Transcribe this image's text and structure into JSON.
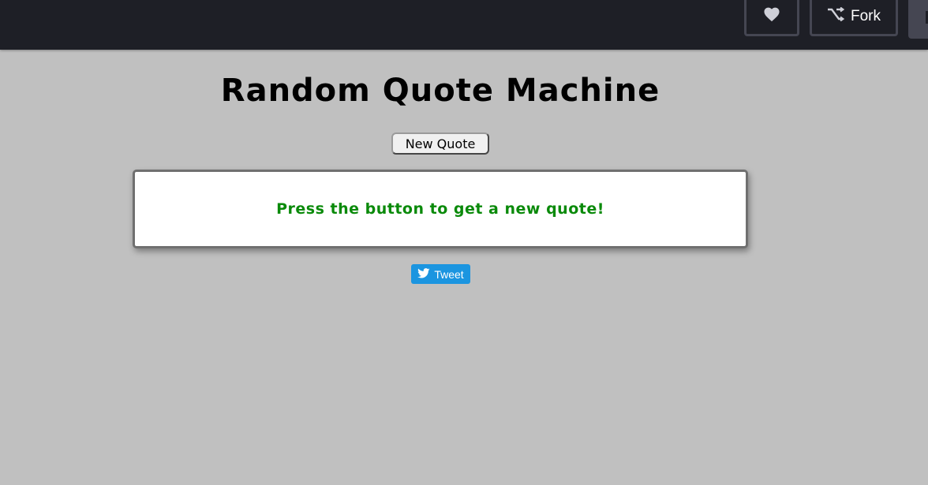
{
  "topbar": {
    "heart_icon": "heart-icon",
    "fork_icon": "fork-icon",
    "fork_label": "Fork",
    "background": "#1e1f26"
  },
  "main": {
    "title": "Random Quote Machine",
    "new_quote_label": "New Quote",
    "quote_text": "Press the button to get a new quote!",
    "quote_color": "#0a8a0a",
    "tweet_label": "Tweet",
    "tweet_icon": "twitter-bird-icon",
    "tweet_color": "#1b95e0",
    "page_background": "#c0c0c0"
  }
}
